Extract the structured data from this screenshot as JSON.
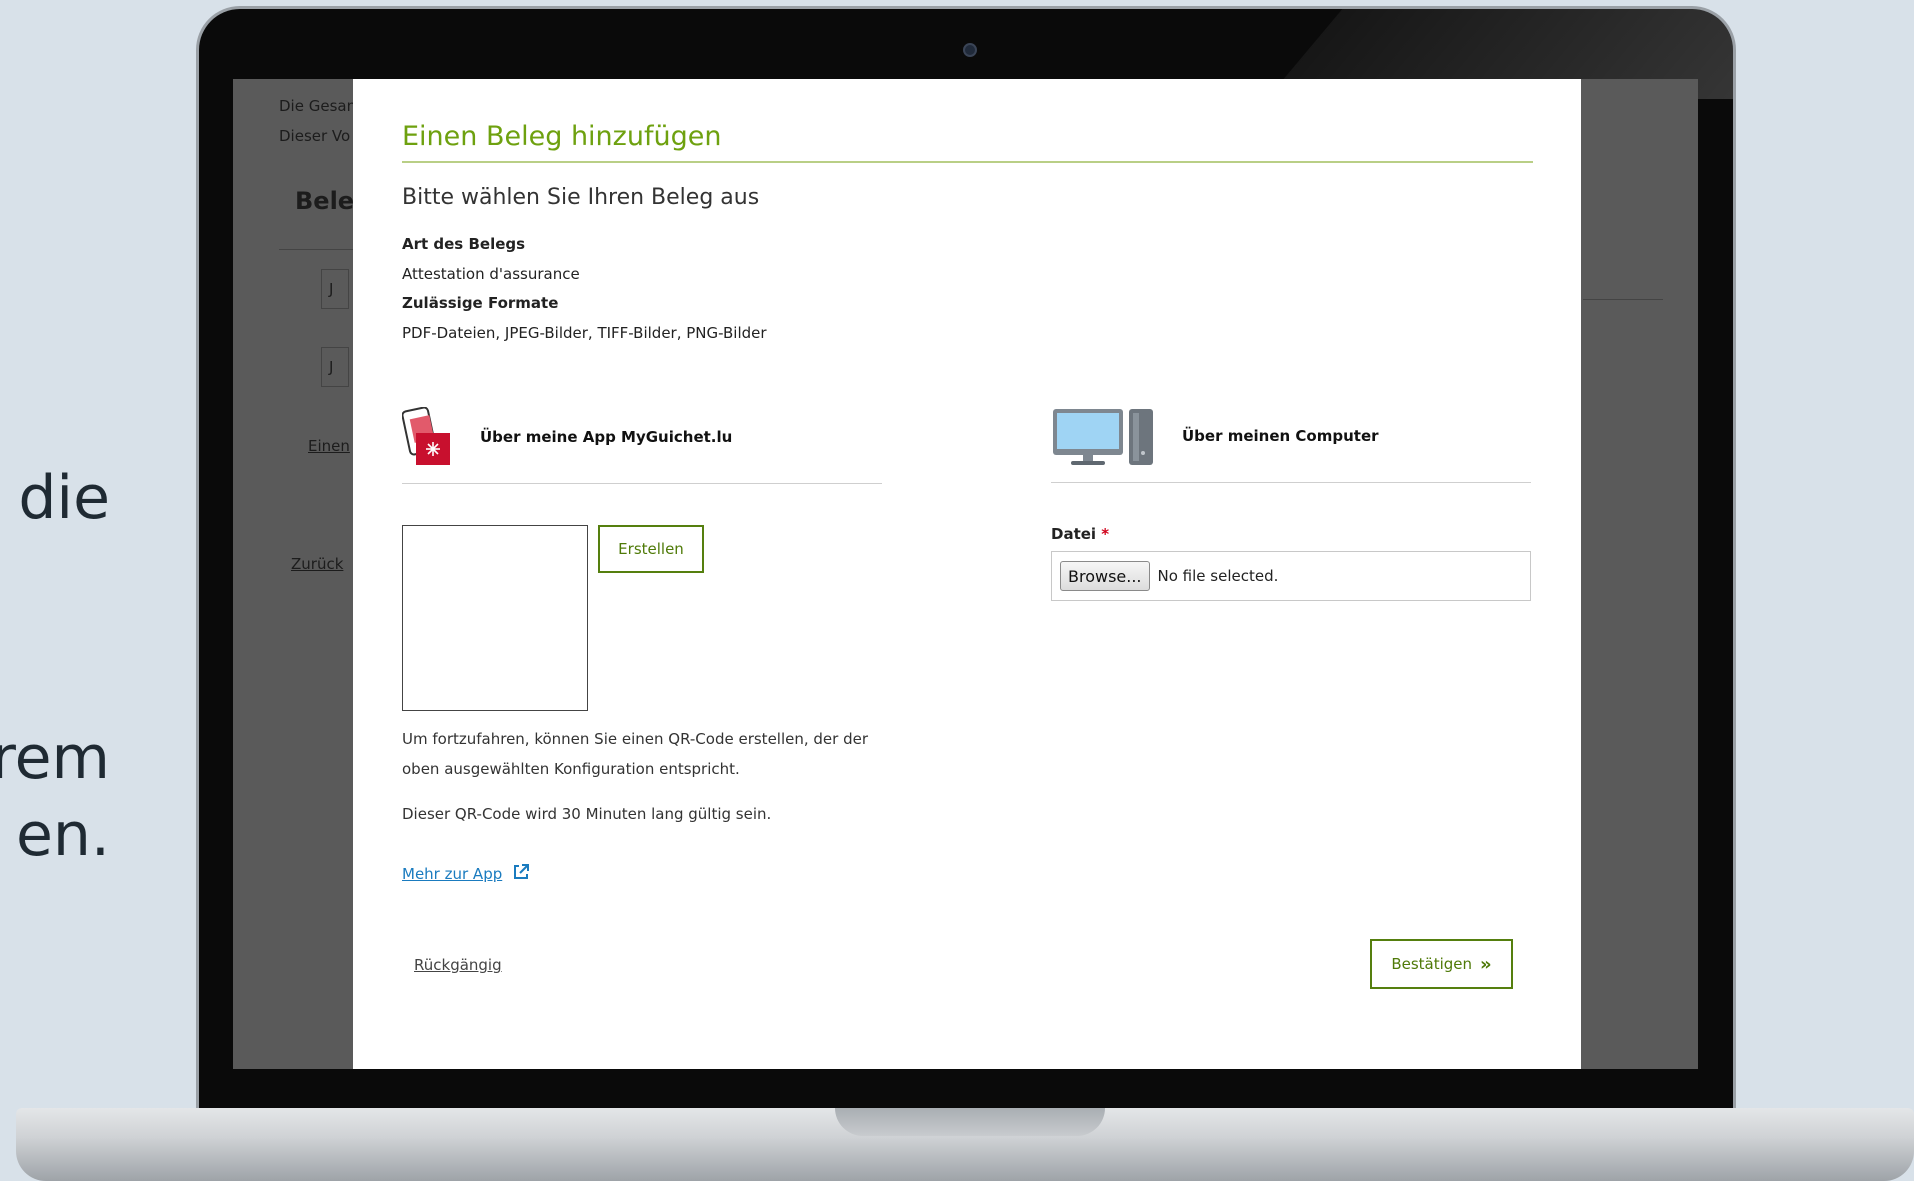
{
  "background": {
    "line1": "r die",
    "line2": "hrem",
    "line3": "en."
  },
  "page": {
    "text1": "Die Gesan",
    "text2": "Dieser Vo",
    "section_title": "Beleg",
    "doc_letter": "J",
    "link_add": "Einen",
    "link_back": "Zurück"
  },
  "modal": {
    "title": "Einen Beleg hinzufügen",
    "subtitle": "Bitte wählen Sie Ihren Beleg aus",
    "type_label": "Art des Belegs",
    "type_value": "Attestation d'assurance",
    "formats_label": "Zulässige Formate",
    "formats_value": "PDF-Dateien, JPEG-Bilder, TIFF-Bilder, PNG-Bilder",
    "app_panel": {
      "heading": "Über meine App MyGuichet.lu",
      "create_button": "Erstellen",
      "description": "Um fortzufahren, können Sie einen QR-Code erstellen, der der oben ausgewählten Konfiguration entspricht.",
      "validity": "Dieser QR-Code wird 30 Minuten lang gültig sein.",
      "more_link": "Mehr zur App"
    },
    "computer_panel": {
      "heading": "Über meinen Computer",
      "file_label": "Datei",
      "required_mark": "*",
      "browse_button": "Browse...",
      "file_status": "No file selected."
    },
    "undo": "Rückgängig",
    "confirm": "Bestätigen",
    "confirm_icon": "»"
  },
  "colors": {
    "accent_green": "#6ea10f",
    "button_green": "#557f0e",
    "link_blue": "#1a7bbf",
    "required_red": "#d0021b"
  }
}
